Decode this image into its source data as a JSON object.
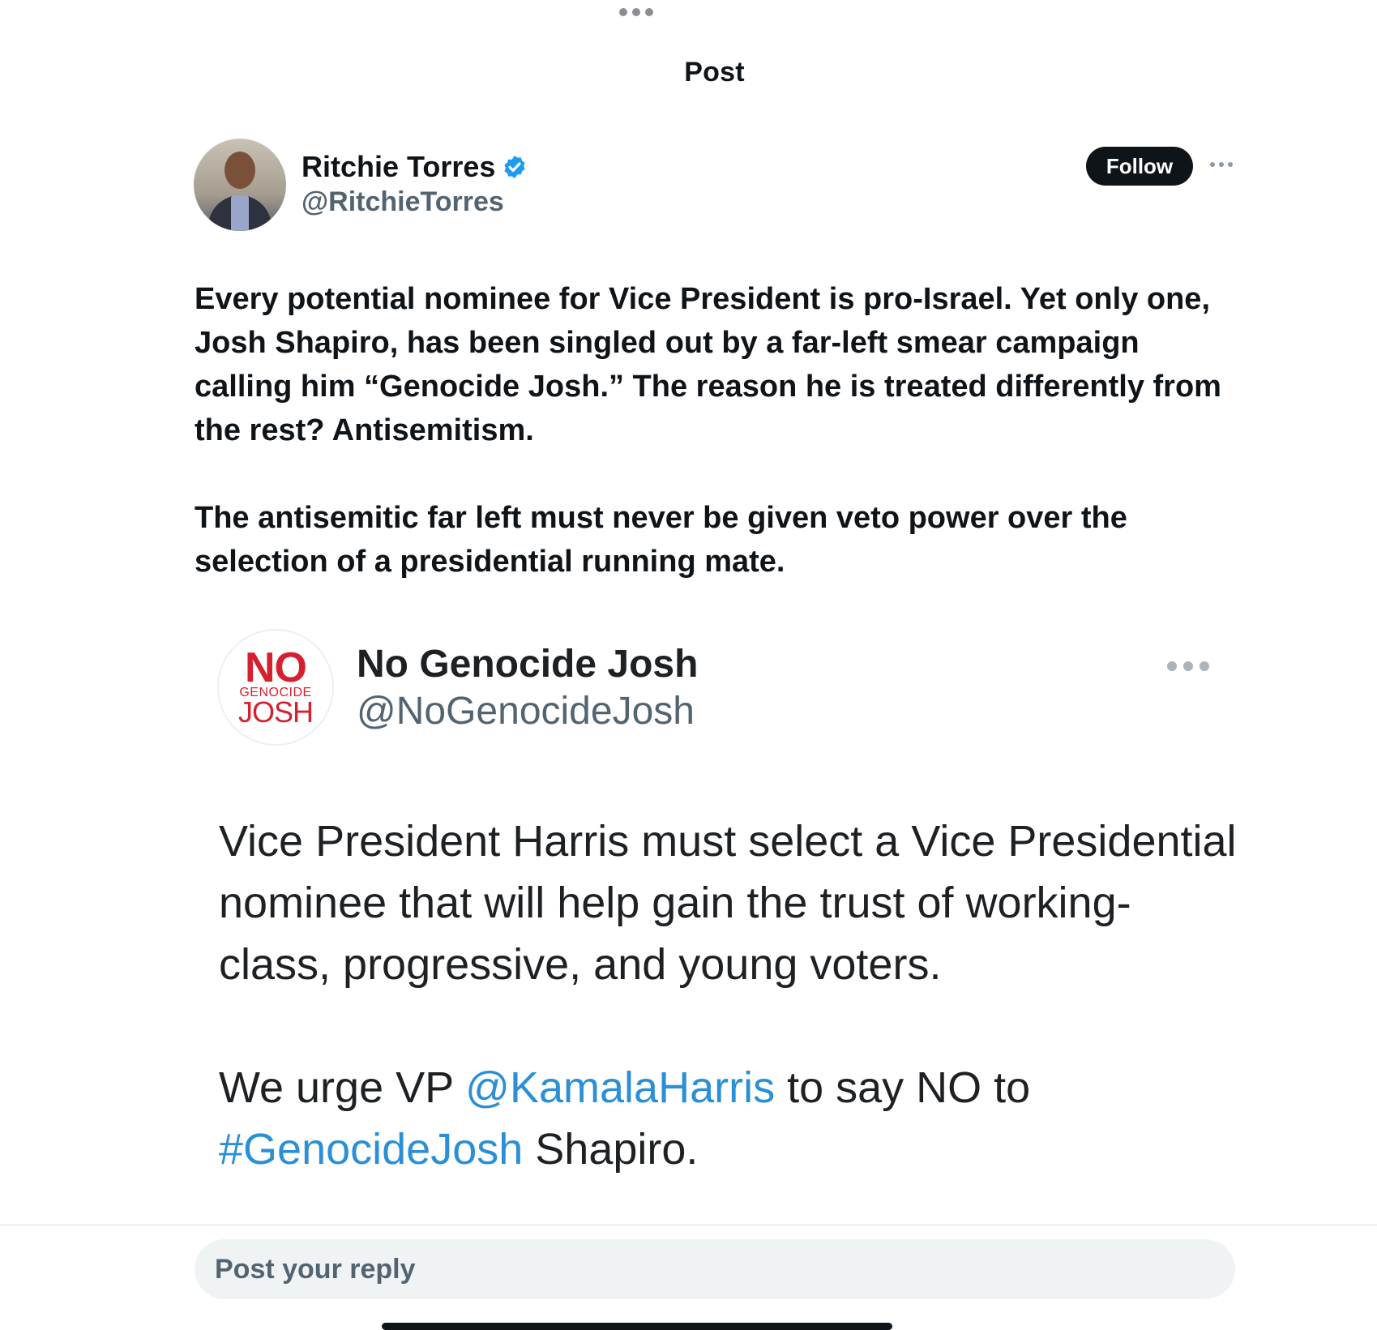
{
  "header": {
    "title": "Post"
  },
  "post": {
    "author_name": "Ritchie Torres",
    "author_handle": "@RitchieTorres",
    "follow_label": "Follow",
    "paragraphs": [
      "Every potential nominee for Vice President is pro-Israel.  Yet only one, Josh Shapiro, has been singled out by a far-left smear campaign calling him “Genocide Josh.” The reason he is treated differently from the rest? Antisemitism.",
      "The antisemitic far left must never be given veto power over the selection of a presidential running mate."
    ]
  },
  "quoted": {
    "avatar_text": {
      "no": "NO",
      "genocide": "GENOCIDE",
      "josh": "JOSH"
    },
    "name": "No Genocide Josh",
    "handle": "@NoGenocideJosh",
    "paragraph1": "Vice President Harris must select a Vice Presidential nominee that will help gain the trust of working-class, progressive, and young voters.",
    "p2_before": "We urge VP ",
    "p2_mention": "@KamalaHarris",
    "p2_middle": " to say NO to ",
    "p2_hashtag": "#GenocideJosh",
    "p2_after": " Shapiro."
  },
  "reply": {
    "placeholder": "Post your reply"
  },
  "colors": {
    "text": "#0f1419",
    "secondary": "#536471",
    "link": "#2a8fd6",
    "verified": "#1d9bf0",
    "logo_red": "#d5212f"
  },
  "icons": [
    "more-dots-icon",
    "verified-badge-icon",
    "overflow-menu-icon"
  ]
}
